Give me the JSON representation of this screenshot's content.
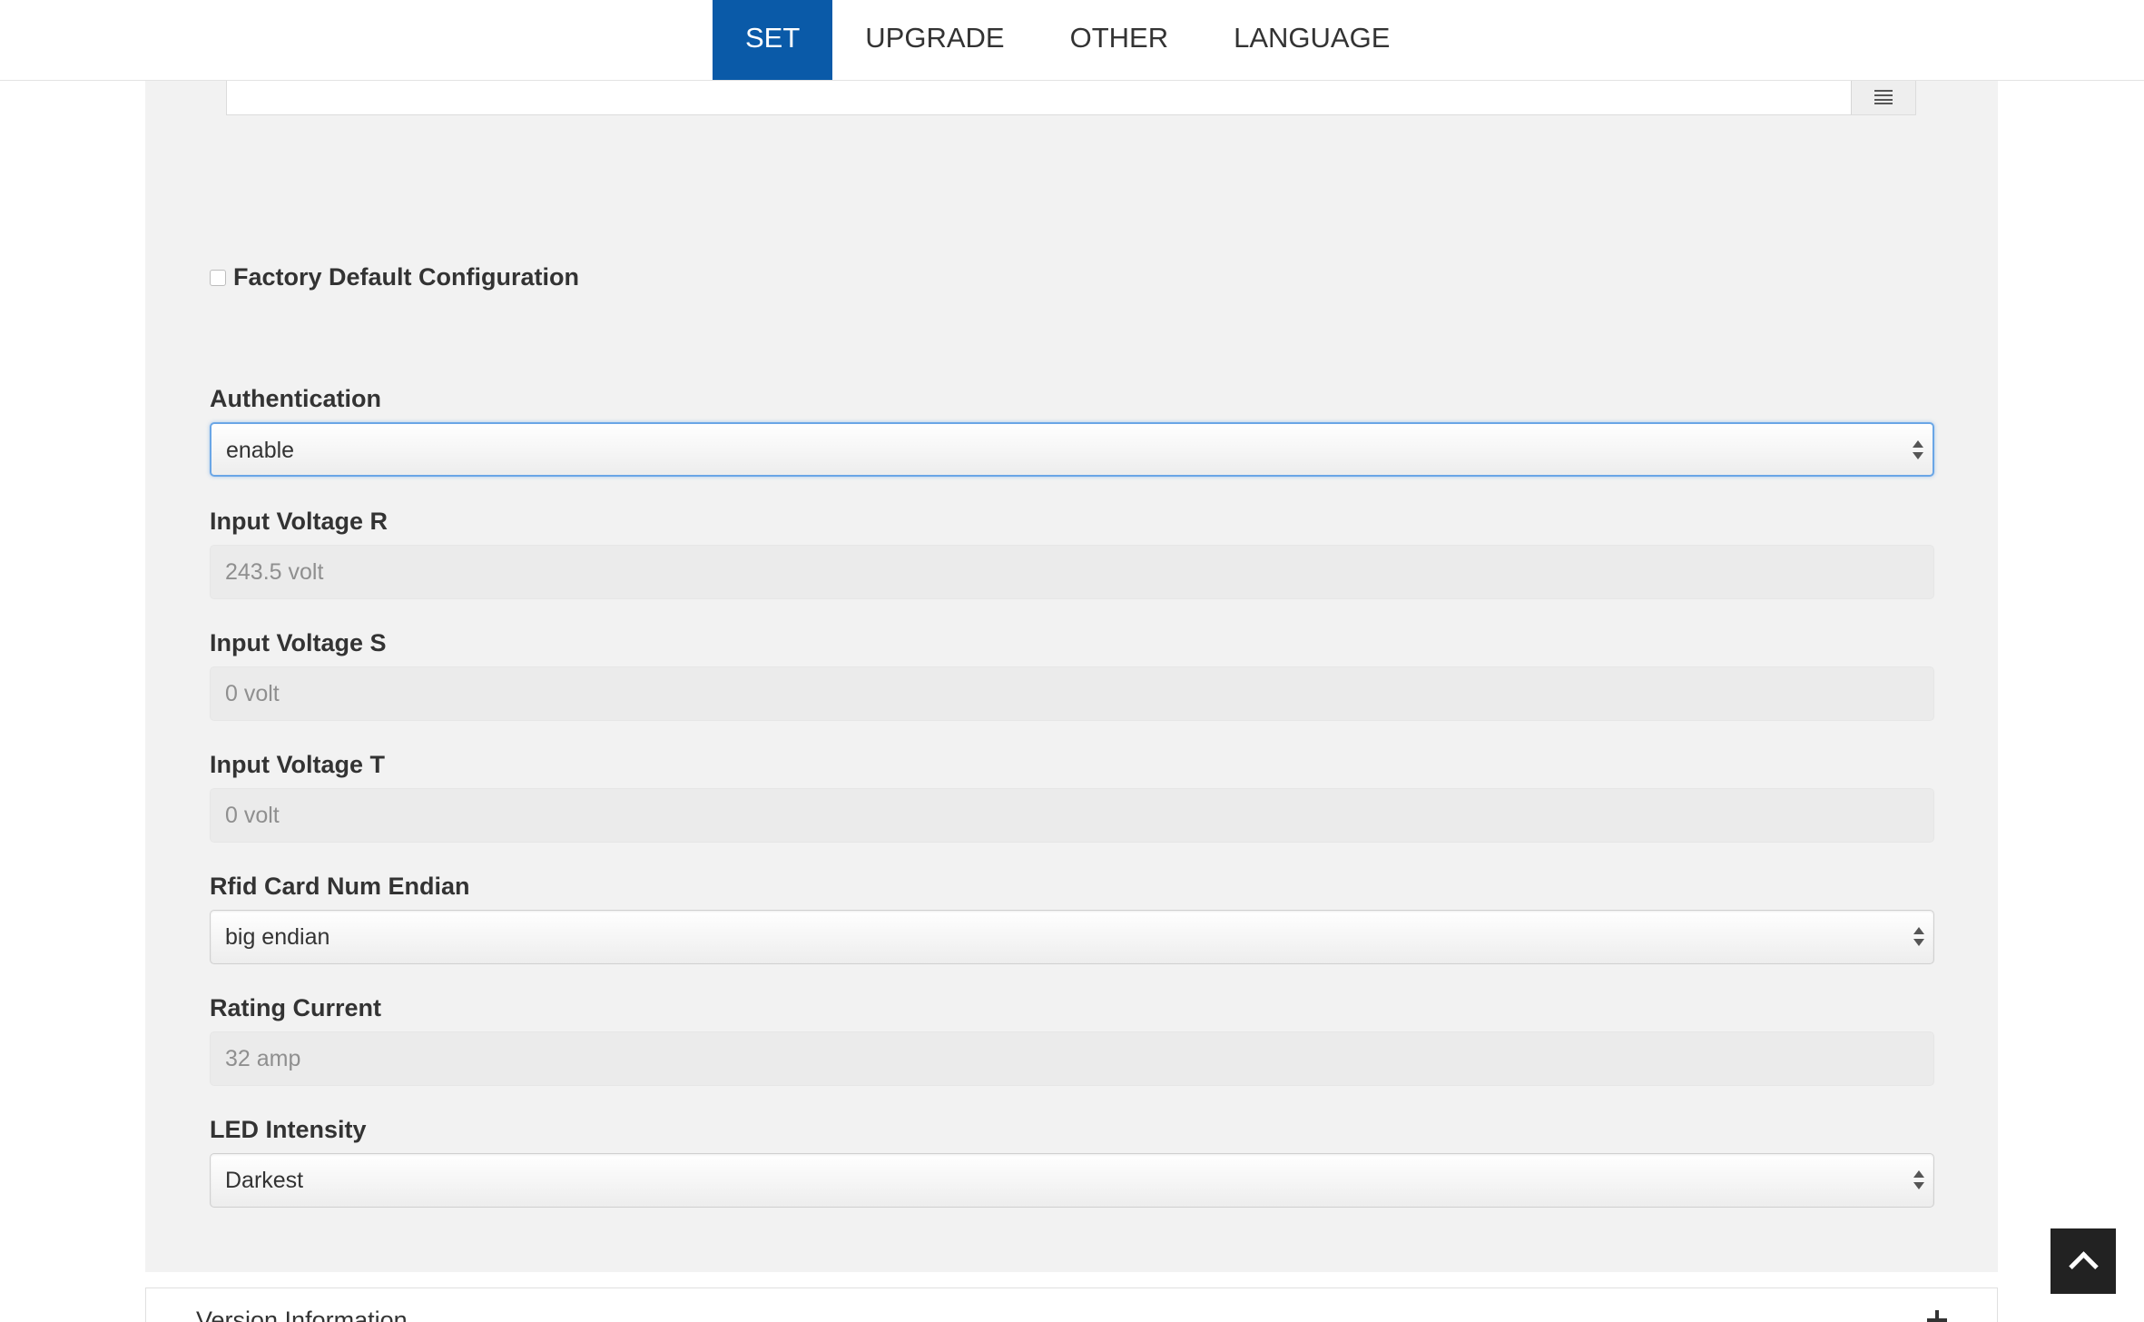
{
  "nav": {
    "tabs": [
      {
        "label": "SET",
        "active": true
      },
      {
        "label": "UPGRADE",
        "active": false
      },
      {
        "label": "OTHER",
        "active": false
      },
      {
        "label": "LANGUAGE",
        "active": false
      }
    ]
  },
  "form": {
    "factory_default": {
      "label": "Factory Default Configuration",
      "checked": false
    },
    "authentication": {
      "label": "Authentication",
      "value": "enable"
    },
    "input_voltage_r": {
      "label": "Input Voltage R",
      "value": "243.5 volt"
    },
    "input_voltage_s": {
      "label": "Input Voltage S",
      "value": "0 volt"
    },
    "input_voltage_t": {
      "label": "Input Voltage T",
      "value": "0 volt"
    },
    "rfid_endian": {
      "label": "Rfid Card Num Endian",
      "value": "big endian"
    },
    "rating_current": {
      "label": "Rating Current",
      "value": "32 amp"
    },
    "led_intensity": {
      "label": "LED Intensity",
      "value": "Darkest"
    }
  },
  "version_panel": {
    "title": "Version Information"
  },
  "colors": {
    "accent": "#0a5aa8",
    "panel_bg": "#f2f2f2",
    "focus": "#6aa6e6"
  },
  "icons": {
    "date_addon": "calendar-icon",
    "expand": "plus-icon",
    "back_to_top": "chevron-up-icon"
  }
}
